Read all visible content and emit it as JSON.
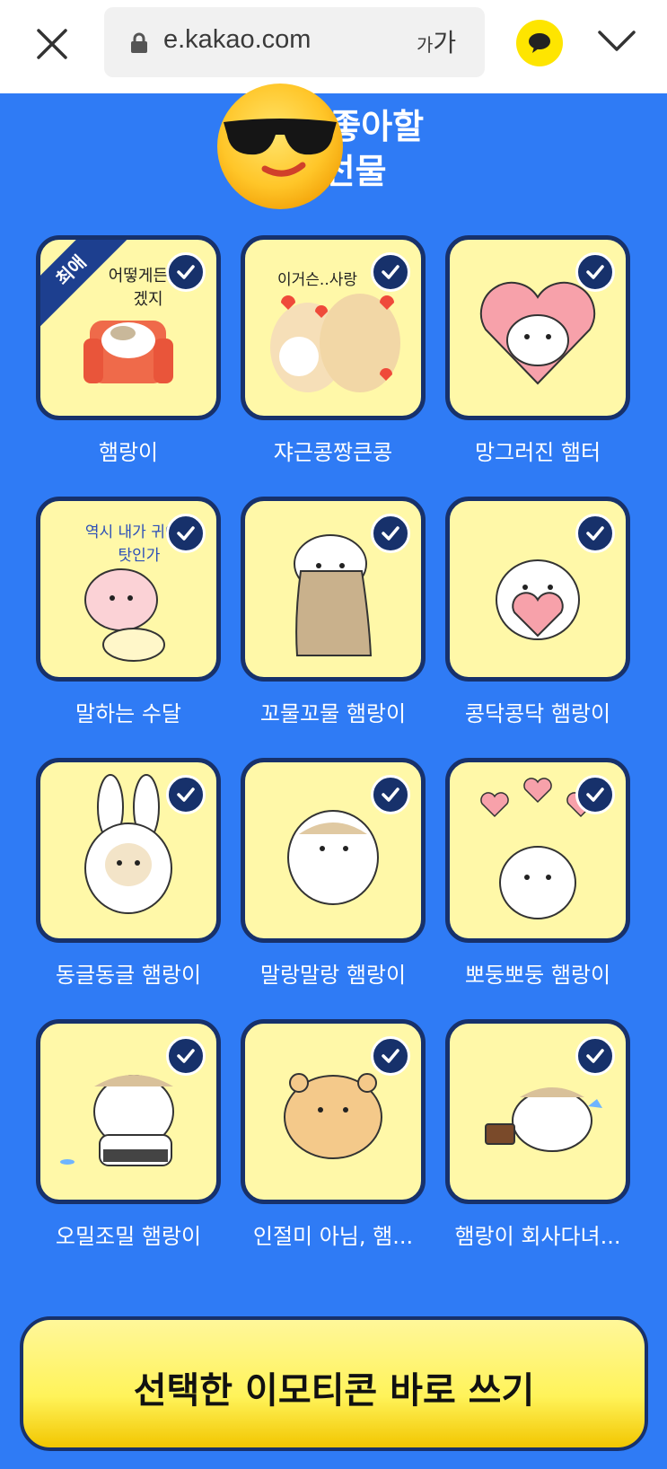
{
  "browser": {
    "url": "e.kakao.com",
    "font_size_label_small": "가",
    "font_size_label_large": "가"
  },
  "header": {
    "title_line1": "김    이 좋아할",
    "title_line2": "콘 선물"
  },
  "items": [
    {
      "name": "햄랑이",
      "ribbon": "최애",
      "art_text": "어떻게든 되겠지"
    },
    {
      "name": "쟈근콩짱큰콩",
      "art_text": "이거슨..사랑"
    },
    {
      "name": "망그러진 햄터"
    },
    {
      "name": "말하는 수달",
      "art_text": "역시 내가 귀여운 탓인가"
    },
    {
      "name": "꼬물꼬물 햄랑이"
    },
    {
      "name": "콩닥콩닥 햄랑이"
    },
    {
      "name": "동글동글 햄랑이"
    },
    {
      "name": "말랑말랑 햄랑이"
    },
    {
      "name": "뽀둥뽀둥 햄랑이"
    },
    {
      "name": "오밀조밀 햄랑이"
    },
    {
      "name": "인절미 아님, 햄..."
    },
    {
      "name": "햄랑이 회사다녀..."
    }
  ],
  "cta": {
    "label": "선택한 이모티콘 바로 쓰기"
  },
  "colors": {
    "background": "#2f7bf5",
    "card": "#fff8a8",
    "card_border": "#17316b",
    "cta": "#fff35a"
  }
}
